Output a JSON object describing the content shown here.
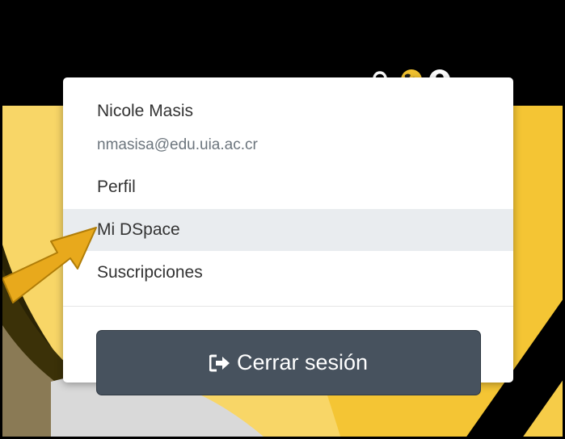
{
  "colors": {
    "navbar": "#000000",
    "accent_yellow": "#f2c230",
    "active_item_bg": "#e9ecef",
    "logout_bg": "#47525e",
    "arrow": "#e8a91c"
  },
  "navbar": {
    "icons": [
      "search-icon",
      "globe-icon",
      "user-circle-icon",
      "caret-down-icon"
    ]
  },
  "user_menu": {
    "name": "Nicole Masis",
    "email": "nmasisa@edu.uia.ac.cr",
    "items": [
      {
        "label": "Perfil"
      },
      {
        "label": "Mi DSpace",
        "active": true
      },
      {
        "label": "Suscripciones"
      }
    ],
    "logout_label": "Cerrar sesión",
    "logout_icon": "sign-out-icon"
  },
  "annotation": {
    "icon": "callout-arrow-icon"
  }
}
